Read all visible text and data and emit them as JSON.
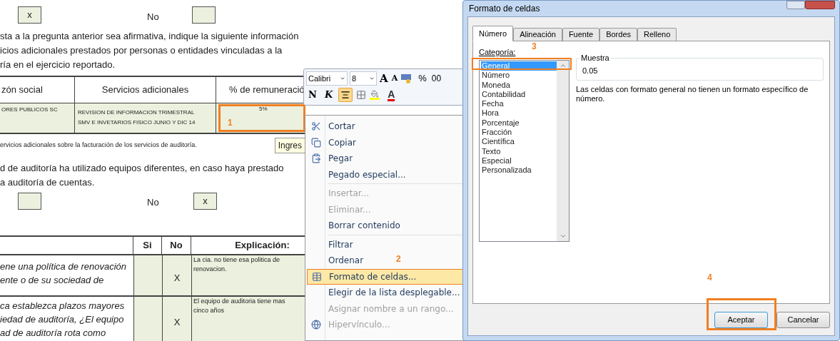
{
  "sheet": {
    "top_row": {
      "box_1": "x",
      "label": "No"
    },
    "intro_lines": [
      "sta a la pregunta anterior sea afirmativa, indique la siguiente información",
      "icios adicionales prestados por personas o entidades vinculadas a la",
      "ría en el ejercicio reportado."
    ],
    "services_table": {
      "columns": [
        "zón social",
        "Servicios adicionales",
        "% de remuneració"
      ],
      "row": {
        "name": "ORES PUBLICOS SC",
        "service_lines": [
          "REVISION DE INFORMACION TRIMESTRAL",
          "SMV E INVETARIOS FISICO JUNIO Y DIC 14"
        ],
        "percent": "5%",
        "annotation": "1"
      }
    },
    "note": "ervicios adicionales sobre la facturación de los servicios de auditoría.",
    "tooltip": "Ingres",
    "question_lines": [
      "d de auditoría ha utilizado equipos diferentes, en caso haya prestado",
      "a auditoría de cuentas."
    ],
    "answer_row": {
      "label": "No",
      "box_2": "x"
    },
    "policy_table": {
      "columns": [
        "Si",
        "No",
        "Explicación:"
      ],
      "rows": [
        {
          "question_lines": [
            "ene una política de renovación",
            "ente o de su sociedad de"
          ],
          "si": "",
          "no": "X",
          "explanation": "La cia. no tiene esa politica de renovacion."
        },
        {
          "question_lines": [
            "ca establezca plazos mayores",
            "iedad de auditoría, ¿El equipo",
            "ad de auditoría rota como"
          ],
          "si": "",
          "no": "X",
          "explanation": "El equipo de auditoria tiene mas cinco años"
        }
      ]
    }
  },
  "mini_toolbar": {
    "font": "Calibri",
    "size": "8",
    "grow": "A",
    "shrink": "A",
    "percent": "%",
    "thousands": "00",
    "bold": "N",
    "italic": "K",
    "center_selected": true,
    "font_color": "A"
  },
  "context_menu": {
    "annotation": "2",
    "items": [
      {
        "kind": "item",
        "label": "Cortar",
        "disabled": false,
        "selected": false
      },
      {
        "kind": "item",
        "label": "Copiar",
        "disabled": false,
        "selected": false
      },
      {
        "kind": "item",
        "label": "Pegar",
        "disabled": false,
        "selected": false
      },
      {
        "kind": "item",
        "label": "Pegado especial...",
        "disabled": false,
        "selected": false
      },
      {
        "kind": "separator"
      },
      {
        "kind": "item",
        "label": "Insertar...",
        "disabled": true,
        "selected": false
      },
      {
        "kind": "item",
        "label": "Eliminar...",
        "disabled": true,
        "selected": false
      },
      {
        "kind": "item",
        "label": "Borrar contenido",
        "disabled": false,
        "selected": false
      },
      {
        "kind": "separator"
      },
      {
        "kind": "item",
        "label": "Filtrar",
        "disabled": false,
        "selected": false
      },
      {
        "kind": "item",
        "label": "Ordenar",
        "disabled": false,
        "selected": false
      },
      {
        "kind": "item",
        "label": "Formato de celdas...",
        "disabled": false,
        "selected": true
      },
      {
        "kind": "item",
        "label": "Elegir de la lista desplegable...",
        "disabled": false,
        "selected": false
      },
      {
        "kind": "item",
        "label": "Asignar nombre a un rango...",
        "disabled": true,
        "selected": false
      },
      {
        "kind": "item",
        "label": "Hipervínculo...",
        "disabled": true,
        "selected": false
      }
    ]
  },
  "dialog": {
    "title": "Formato de celdas",
    "tabs": [
      {
        "label": "Número",
        "selected": true
      },
      {
        "label": "Alineación",
        "selected": false
      },
      {
        "label": "Fuente",
        "selected": false
      },
      {
        "label": "Bordes",
        "selected": false
      },
      {
        "label": "Relleno",
        "selected": false
      }
    ],
    "category_label": "Categoría:",
    "annotation_3": "3",
    "categories": [
      {
        "label": "General",
        "selected": true
      },
      {
        "label": "Número",
        "selected": false
      },
      {
        "label": "Moneda",
        "selected": false
      },
      {
        "label": "Contabilidad",
        "selected": false
      },
      {
        "label": "Fecha",
        "selected": false
      },
      {
        "label": "Hora",
        "selected": false
      },
      {
        "label": "Porcentaje",
        "selected": false
      },
      {
        "label": "Fracción",
        "selected": false
      },
      {
        "label": "Científica",
        "selected": false
      },
      {
        "label": "Texto",
        "selected": false
      },
      {
        "label": "Especial",
        "selected": false
      },
      {
        "label": "Personalizada",
        "selected": false
      }
    ],
    "sample_label": "Muestra",
    "sample_value": "0.05",
    "description": "Las celdas con formato general no tienen un formato específico de número.",
    "annotation_4": "4",
    "buttons": [
      "Aceptar",
      "Cancelar"
    ]
  }
}
